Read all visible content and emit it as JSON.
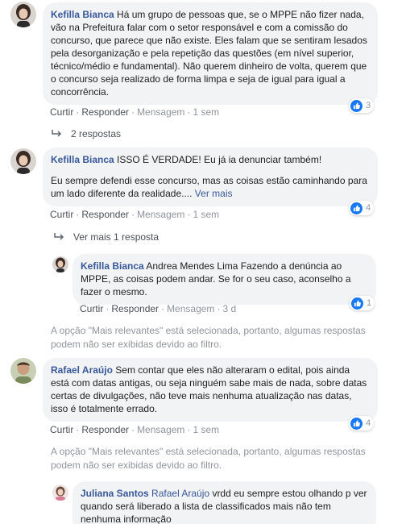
{
  "comments": [
    {
      "author": "Kefilla Bianca",
      "text": "Há um grupo de pessoas que, se o MPPE não fizer nada, vão na Prefeitura falar com o setor responsável e com a comissão do concurso, que parece que não existe. Eles falam que se sentiram lesados pela desorganização e pela repetição das questões (em nível superior, técnico/médio e fundamental). Não querem dinheiro de volta, querem que o concurso seja realizado de forma limpa e seja de igual para igual a concorrência.",
      "actions": [
        "Curtir",
        "Responder",
        "Mensagem",
        "1 sem"
      ],
      "reactions": "3",
      "replies_link": "2 respostas"
    },
    {
      "author": "Kefilla Bianca",
      "text": "ISSO É VERDADE! Eu já ia denunciar também!",
      "text2": "Eu sempre defendi esse concurso, mas as coisas estão caminhando para um lado diferente da realidade....",
      "see_more": "Ver mais",
      "actions": [
        "Curtir",
        "Responder",
        "Mensagem",
        "1 sem"
      ],
      "reactions": "4",
      "replies_link": "Ver mais 1 resposta"
    },
    {
      "author": "Kefilla Bianca",
      "text": "Andrea Mendes Lima Fazendo a denúncia ao MPPE, as coisas podem andar. Se for o seu caso, aconselho a fazer o mesmo.",
      "actions": [
        "Curtir",
        "Responder",
        "Mensagem",
        "3 d"
      ],
      "reactions": "1"
    },
    {
      "author": "Rafael Araújo",
      "text": "Sem contar que eles não alteraram o edital, pois ainda está com datas antigas, ou seja ninguém sabe mais de nada, sobre datas certas de divulgações, não teve mais nenhuma atualização nas datas, isso é totalmente errado.",
      "actions": [
        "Curtir",
        "Responder",
        "Mensagem",
        "1 sem"
      ],
      "reactions": "4"
    },
    {
      "author": "Juliana Santos",
      "tag": "Rafael Araújo",
      "text": "vrdd eu sempre estou olhando p ver quando será liberado a lista de classificados mais não tem nenhuma informação"
    }
  ],
  "filter_note": "A opção \"Mais relevantes\" está selecionada, portanto, algumas respostas podem não ser exibidas devido ao filtro.",
  "colors": {
    "link": "#385898",
    "bubble": "#f2f3f5",
    "like": "#1877f2",
    "meta": "#90949c"
  }
}
